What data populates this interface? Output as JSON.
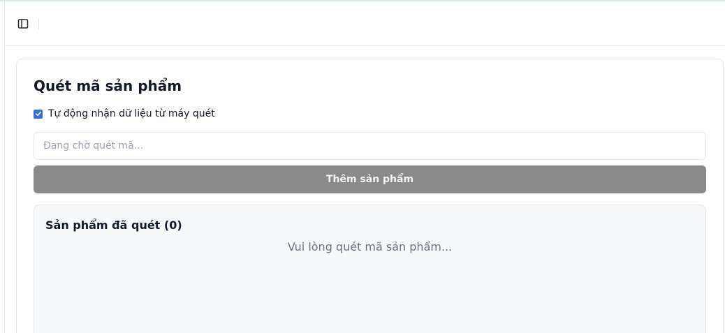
{
  "header": {
    "sidebar_toggle_icon": "sidebar-panel-icon"
  },
  "scanner": {
    "title": "Quét mã sản phẩm",
    "auto_receive": {
      "checked": true,
      "label": "Tự động nhận dữ liệu từ máy quét"
    },
    "input": {
      "value": "",
      "placeholder": "Đang chờ quét mã..."
    },
    "add_button_label": "Thêm sản phẩm",
    "scanned": {
      "title": "Sản phẩm đã quét (0)",
      "empty_message": "Vui lòng quét mã sản phẩm..."
    }
  },
  "colors": {
    "checkbox": "#2f6fe0",
    "button_disabled": "#8a8a8a",
    "panel_bg": "#f8f9fb",
    "border": "#e5e7eb"
  }
}
